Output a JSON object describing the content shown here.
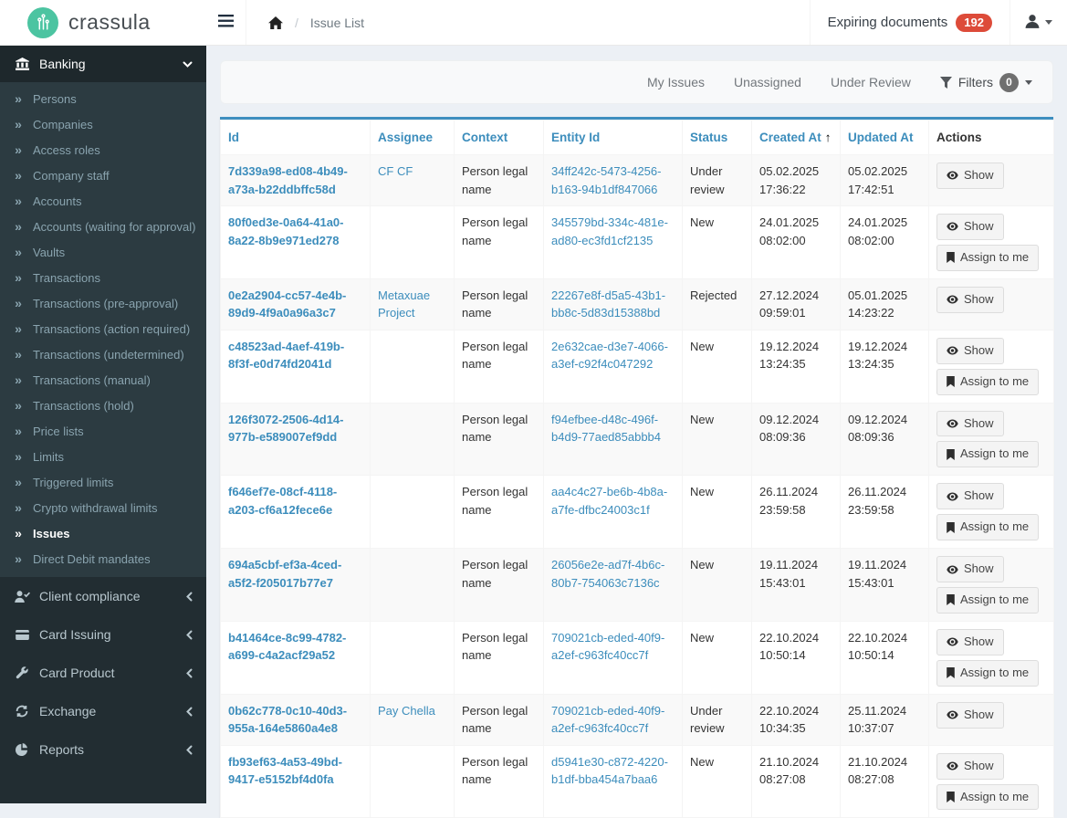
{
  "topbar": {
    "brand": "crassula",
    "breadcrumb_page": "Issue List",
    "breadcrumb_separator": "/",
    "expiring_label": "Expiring documents",
    "expiring_count": "192"
  },
  "sidebar": {
    "banking": {
      "label": "Banking",
      "icon": "bank-icon",
      "expanded": true,
      "items": [
        {
          "label": "Persons"
        },
        {
          "label": "Companies"
        },
        {
          "label": "Access roles"
        },
        {
          "label": "Company staff"
        },
        {
          "label": "Accounts"
        },
        {
          "label": "Accounts (waiting for approval)"
        },
        {
          "label": "Vaults"
        },
        {
          "label": "Transactions"
        },
        {
          "label": "Transactions (pre-approval)"
        },
        {
          "label": "Transactions (action required)"
        },
        {
          "label": "Transactions (undetermined)"
        },
        {
          "label": "Transactions (manual)"
        },
        {
          "label": "Transactions (hold)"
        },
        {
          "label": "Price lists"
        },
        {
          "label": "Limits"
        },
        {
          "label": "Triggered limits"
        },
        {
          "label": "Crypto withdrawal limits"
        },
        {
          "label": "Issues",
          "active": true
        },
        {
          "label": "Direct Debit mandates"
        }
      ]
    },
    "sections": [
      {
        "label": "Client compliance",
        "icon": "user-check-icon"
      },
      {
        "label": "Card Issuing",
        "icon": "credit-card-icon"
      },
      {
        "label": "Card Product",
        "icon": "wrench-icon"
      },
      {
        "label": "Exchange",
        "icon": "exchange-icon"
      },
      {
        "label": "Reports",
        "icon": "pie-chart-icon"
      }
    ]
  },
  "tabs": [
    {
      "label": "My Issues"
    },
    {
      "label": "Unassigned"
    },
    {
      "label": "Under Review"
    }
  ],
  "filters": {
    "label": "Filters",
    "count": "0"
  },
  "actions": {
    "show": "Show",
    "assign": "Assign to me"
  },
  "table": {
    "columns": [
      "Id",
      "Assignee",
      "Context",
      "Entity Id",
      "Status",
      "Created At",
      "Updated At",
      "Actions"
    ],
    "sort": {
      "column": "Created At",
      "direction": "asc"
    },
    "rows": [
      {
        "id": "7d339a98-ed08-4b49-a73a-b22ddbffc58d",
        "assignee": "CF CF",
        "context": "Person legal name",
        "entity_id": "34ff242c-5473-4256-b163-94b1df847066",
        "status": "Under review",
        "created_at": "05.02.2025 17:36:22",
        "updated_at": "05.02.2025 17:42:51",
        "actions": [
          "show"
        ]
      },
      {
        "id": "80f0ed3e-0a64-41a0-8a22-8b9e971ed278",
        "assignee": "",
        "context": "Person legal name",
        "entity_id": "345579bd-334c-481e-ad80-ec3fd1cf2135",
        "status": "New",
        "created_at": "24.01.2025 08:02:00",
        "updated_at": "24.01.2025 08:02:00",
        "actions": [
          "show",
          "assign"
        ]
      },
      {
        "id": "0e2a2904-cc57-4e4b-89d9-4f9a0a96a3c7",
        "assignee": "Metaxuae Project",
        "context": "Person legal name",
        "entity_id": "22267e8f-d5a5-43b1-bb8c-5d83d15388bd",
        "status": "Rejected",
        "created_at": "27.12.2024 09:59:01",
        "updated_at": "05.01.2025 14:23:22",
        "actions": [
          "show"
        ]
      },
      {
        "id": "c48523ad-4aef-419b-8f3f-e0d74fd2041d",
        "assignee": "",
        "context": "Person legal name",
        "entity_id": "2e632cae-d3e7-4066-a3ef-c92f4c047292",
        "status": "New",
        "created_at": "19.12.2024 13:24:35",
        "updated_at": "19.12.2024 13:24:35",
        "actions": [
          "show",
          "assign"
        ]
      },
      {
        "id": "126f3072-2506-4d14-977b-e589007ef9dd",
        "assignee": "",
        "context": "Person legal name",
        "entity_id": "f94efbee-d48c-496f-b4d9-77aed85abbb4",
        "status": "New",
        "created_at": "09.12.2024 08:09:36",
        "updated_at": "09.12.2024 08:09:36",
        "actions": [
          "show",
          "assign"
        ]
      },
      {
        "id": "f646ef7e-08cf-4118-a203-cf6a12fece6e",
        "assignee": "",
        "context": "Person legal name",
        "entity_id": "aa4c4c27-be6b-4b8a-a7fe-dfbc24003c1f",
        "status": "New",
        "created_at": "26.11.2024 23:59:58",
        "updated_at": "26.11.2024 23:59:58",
        "actions": [
          "show",
          "assign"
        ]
      },
      {
        "id": "694a5cbf-ef3a-4ced-a5f2-f205017b77e7",
        "assignee": "",
        "context": "Person legal name",
        "entity_id": "26056e2e-ad7f-4b6c-80b7-754063c7136c",
        "status": "New",
        "created_at": "19.11.2024 15:43:01",
        "updated_at": "19.11.2024 15:43:01",
        "actions": [
          "show",
          "assign"
        ]
      },
      {
        "id": "b41464ce-8c99-4782-a699-c4a2acf29a52",
        "assignee": "",
        "context": "Person legal name",
        "entity_id": "709021cb-eded-40f9-a2ef-c963fc40cc7f",
        "status": "New",
        "created_at": "22.10.2024 10:50:14",
        "updated_at": "22.10.2024 10:50:14",
        "actions": [
          "show",
          "assign"
        ]
      },
      {
        "id": "0b62c778-0c10-40d3-955a-164e5860a4e8",
        "assignee": "Pay Chella",
        "context": "Person legal name",
        "entity_id": "709021cb-eded-40f9-a2ef-c963fc40cc7f",
        "status": "Under review",
        "created_at": "22.10.2024 10:34:35",
        "updated_at": "25.11.2024 10:37:07",
        "actions": [
          "show"
        ]
      },
      {
        "id": "fb93ef63-4a53-49bd-9417-e5152bf4d0fa",
        "assignee": "",
        "context": "Person legal name",
        "entity_id": "d5941e30-c872-4220-b1df-bba454a7baa6",
        "status": "New",
        "created_at": "21.10.2024 08:27:08",
        "updated_at": "21.10.2024 08:27:08",
        "actions": [
          "show",
          "assign"
        ]
      }
    ]
  },
  "colors": {
    "accent_blue": "#3c8dbc",
    "sidebar_bg": "#222d32",
    "sidebar_submenu_bg": "#2c3b41",
    "sidebar_active_bg": "#1e282c",
    "badge_red": "#dd4b39",
    "logo_green": "#4cc4a1",
    "filters_badge_gray": "#6f6f6f",
    "content_bg": "#ecf0f5"
  }
}
